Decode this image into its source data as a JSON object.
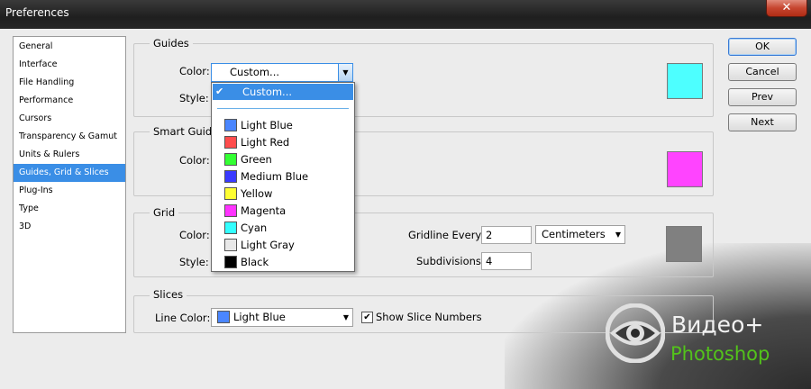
{
  "window": {
    "title": "Preferences",
    "close_glyph": "✕"
  },
  "sidebar": {
    "items": [
      {
        "label": "General"
      },
      {
        "label": "Interface"
      },
      {
        "label": "File Handling"
      },
      {
        "label": "Performance"
      },
      {
        "label": "Cursors"
      },
      {
        "label": "Transparency & Gamut"
      },
      {
        "label": "Units & Rulers"
      },
      {
        "label": "Guides, Grid & Slices",
        "selected": true
      },
      {
        "label": "Plug-Ins"
      },
      {
        "label": "Type"
      },
      {
        "label": "3D"
      }
    ]
  },
  "buttons": {
    "ok": "OK",
    "cancel": "Cancel",
    "prev": "Prev",
    "next": "Next"
  },
  "guides": {
    "title": "Guides",
    "color_label": "Color:",
    "color_value": "Custom...",
    "style_label": "Style:",
    "swatch_color": "#4dffff"
  },
  "smart_guides": {
    "title": "Smart Guides",
    "color_label": "Color:",
    "swatch_color": "#ff44ff"
  },
  "grid": {
    "title": "Grid",
    "color_label": "Color:",
    "style_label": "Style:",
    "gridline_label": "Gridline Every:",
    "gridline_value": "2",
    "units_value": "Centimeters",
    "subdivisions_label": "Subdivisions:",
    "subdivisions_value": "4",
    "swatch_color": "#808080"
  },
  "slices": {
    "title": "Slices",
    "line_color_label": "Line Color:",
    "line_color_value": "Light Blue",
    "line_color_swatch": "#4a86ff",
    "show_numbers_label": "Show Slice Numbers",
    "show_numbers_checked": true
  },
  "color_dropdown": {
    "selected": "Custom...",
    "options": [
      {
        "label": "Light Blue",
        "color": "#4a86ff"
      },
      {
        "label": "Light Red",
        "color": "#ff4d4d"
      },
      {
        "label": "Green",
        "color": "#33ff33"
      },
      {
        "label": "Medium Blue",
        "color": "#3a3aff"
      },
      {
        "label": "Yellow",
        "color": "#ffff33"
      },
      {
        "label": "Magenta",
        "color": "#ff33ff"
      },
      {
        "label": "Cyan",
        "color": "#33ffff"
      },
      {
        "label": "Light Gray",
        "color": "#e8e8e8"
      },
      {
        "label": "Black",
        "color": "#000000"
      }
    ]
  },
  "watermark": {
    "line1": "Видео+",
    "line2": "Photoshop",
    "line2_color": "#53c31b"
  }
}
